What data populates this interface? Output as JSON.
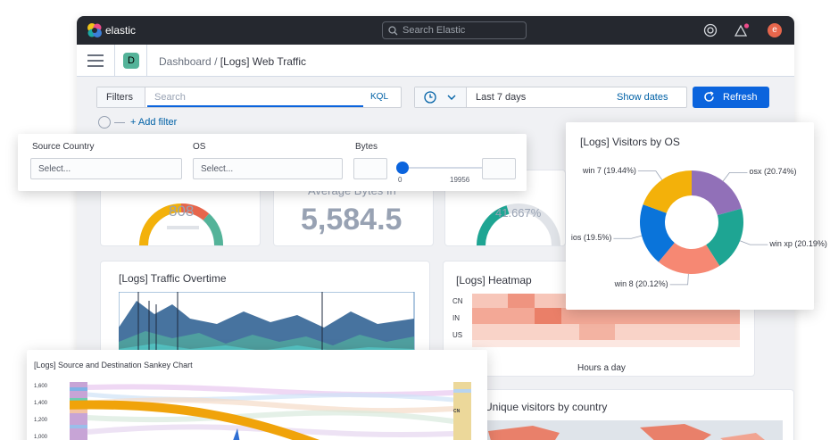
{
  "topbar": {
    "brand": "elastic",
    "search_placeholder": "Search Elastic",
    "avatar_initial": "e"
  },
  "breadcrumb": {
    "app_badge": "D",
    "parent": "Dashboard",
    "separator": "/",
    "current": "[Logs] Web Traffic"
  },
  "querybar": {
    "filters_label": "Filters",
    "search_placeholder": "Search",
    "language": "KQL",
    "add_filter": "+ Add filter"
  },
  "timepicker": {
    "range": "Last 7 days",
    "show_dates": "Show dates",
    "refresh": "Refresh"
  },
  "controls": {
    "source_country": {
      "label": "Source Country",
      "placeholder": "Select..."
    },
    "os": {
      "label": "OS",
      "placeholder": "Select..."
    },
    "bytes": {
      "label": "Bytes",
      "min": "0",
      "max": "19956",
      "slider_value": 0.0
    }
  },
  "metrics": {
    "gauge1": {
      "value": "808"
    },
    "average_bytes": {
      "label": "Average Bytes In",
      "value": "5,584.5"
    },
    "gauge2": {
      "value": "41.667%"
    }
  },
  "panels": {
    "traffic": {
      "title": "[Logs] Traffic Overtime"
    },
    "heatmap": {
      "title": "[Logs] Heatmap",
      "rows": [
        "CN",
        "IN",
        "US"
      ],
      "xlabel": "Hours a day"
    },
    "visitors_country": {
      "title": "Unique visitors by country"
    }
  },
  "visitors_os": {
    "title": "[Logs] Visitors by OS",
    "chart_data": {
      "type": "pie",
      "donut": true,
      "slices": [
        {
          "label": "osx (20.74%)",
          "value": 20.74,
          "color": "#9170b8"
        },
        {
          "label": "win xp (20.19%)",
          "value": 20.19,
          "color": "#1ea593"
        },
        {
          "label": "win 8 (20.12%)",
          "value": 20.12,
          "color": "#f68873"
        },
        {
          "label": "ios (19.5%)",
          "value": 19.5,
          "color": "#0a74da"
        },
        {
          "label": "win 7 (19.44%)",
          "value": 19.44,
          "color": "#f3b10a"
        }
      ]
    }
  },
  "sankey": {
    "title": "[Logs] Source and Destination Sankey Chart",
    "y_ticks": [
      "1,600",
      "1,400",
      "1,200",
      "1,000"
    ],
    "node_label": "CN"
  },
  "colors": {
    "accent": "#0b64dd",
    "link": "#0061a6",
    "topbar": "#25282f"
  }
}
